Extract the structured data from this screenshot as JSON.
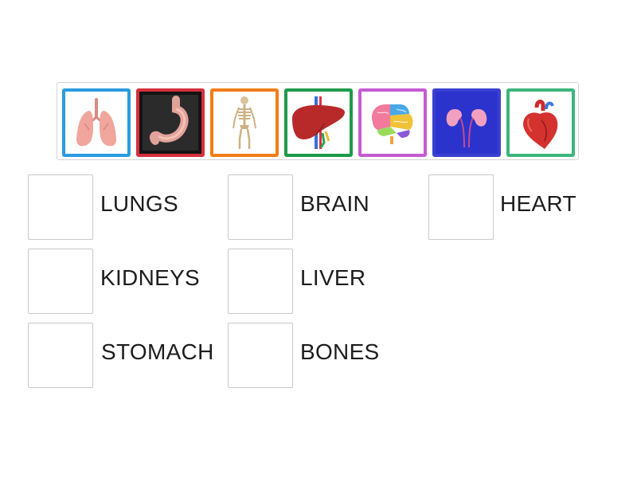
{
  "tiles": [
    {
      "icon": "lungs-icon",
      "border": "#2a9be0"
    },
    {
      "icon": "stomach-icon",
      "border": "#d62f3c"
    },
    {
      "icon": "skeleton-icon",
      "border": "#f07d18"
    },
    {
      "icon": "liver-icon",
      "border": "#1e9a4a"
    },
    {
      "icon": "brain-icon",
      "border": "#c65ad2"
    },
    {
      "icon": "kidneys-icon",
      "border": "#3940d2"
    },
    {
      "icon": "heart-icon",
      "border": "#3db57c"
    }
  ],
  "labels": {
    "lungs": "LUNGS",
    "brain": "BRAIN",
    "heart": "HEART",
    "kidneys": "KIDNEYS",
    "liver": "LIVER",
    "stomach": "STOMACH",
    "bones": "BONES"
  }
}
